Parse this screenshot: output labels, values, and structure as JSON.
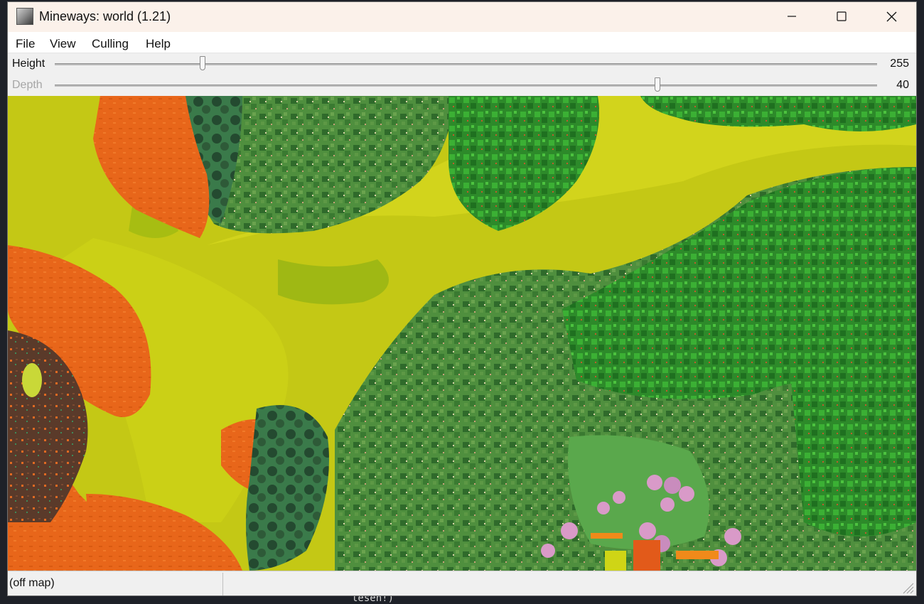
{
  "window": {
    "title": "Mineways: world (1.21)"
  },
  "menu": {
    "items": [
      "File",
      "View",
      "Culling",
      "Help"
    ]
  },
  "sliders": {
    "height": {
      "label": "Height",
      "value": "255",
      "fraction": 0.18
    },
    "depth": {
      "label": "Depth",
      "value": "40",
      "fraction": 0.733
    }
  },
  "status": {
    "pane1": "(off map)"
  },
  "background": {
    "fragment": "lesen!)"
  },
  "colors": {
    "titlebar": "#fbf1ea",
    "sand": "#c4c815",
    "orange": "#e86a1a",
    "forest": "#2f7d2a",
    "dark_forest": "#2c5e28",
    "cherry": "#d99ac8"
  }
}
